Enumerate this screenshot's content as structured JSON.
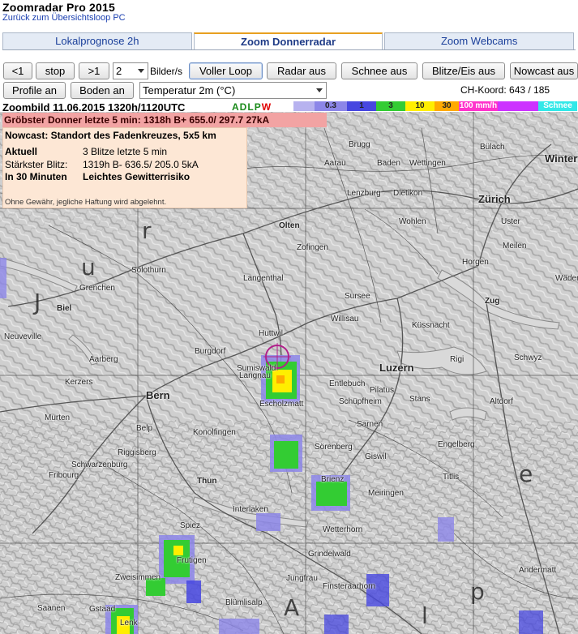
{
  "app": {
    "title": "Zoomradar Pro 2015",
    "back_link": "Zurück zum Übersichtsloop PC"
  },
  "tabs": [
    {
      "label": "Lokalprognose 2h",
      "active": false
    },
    {
      "label": "Zoom Donnerradar",
      "active": true
    },
    {
      "label": "Zoom Webcams",
      "active": false
    }
  ],
  "controls": {
    "prev": "<1",
    "stop": "stop",
    "next": ">1",
    "speed_value": "2",
    "speed_label": "Bilder/s",
    "full_loop": "Voller Loop",
    "radar_off": "Radar aus",
    "snow_off": "Schnee aus",
    "lightning_off": "Blitze/Eis aus",
    "nowcast_off": "Nowcast aus",
    "profile_on": "Profile an",
    "ground_on": "Boden an",
    "layer_select": "Temperatur 2m (°C)",
    "ch_koord": "CH-Koord: 643 / 185"
  },
  "zoom": {
    "label": "Zoombild  11.06.2015  1320h/1120UTC",
    "adlpw": [
      "A",
      "D",
      "L",
      "P",
      "W"
    ],
    "adlpw_colors": [
      "#1a8a1a",
      "#1a8a1a",
      "#1a8a1a",
      "#1a8a1a",
      "#e00000"
    ]
  },
  "legend": [
    {
      "label": "",
      "color": "#b7b2ef"
    },
    {
      "label": "0.3",
      "color": "#8c86e8"
    },
    {
      "label": "1",
      "color": "#4747e0"
    },
    {
      "label": "3",
      "color": "#33cc33"
    },
    {
      "label": "10",
      "color": "#ffee00"
    },
    {
      "label": "30",
      "color": "#ffaa00"
    },
    {
      "label": "100 mm/h",
      "color": "#ff33cc"
    },
    {
      "label": "",
      "color": "#cc33ff"
    },
    {
      "label": "Schnee",
      "color": "#33e8e8"
    }
  ],
  "alert": {
    "gruebster": "Gröbster Donner letzte 5 min: 1318h B+ 655.0/ 297.7  27kA"
  },
  "nowcast": {
    "title": "Nowcast: Standort des Fadenkreuzes, 5x5 km",
    "aktuell_label": "Aktuell",
    "aktuell_value": "3 Blitze letzte 5 min",
    "staerkster_label": "Stärkster Blitz:",
    "staerkster_value": "1319h B- 636.5/ 205.0    5kA",
    "in30_label": "In 30 Minuten",
    "in30_value": "Leichtes Gewitterrisiko",
    "disclaimer": "Ohne Gewähr, jegliche Haftung wird abgelehnt."
  },
  "map": {
    "places": [
      {
        "name": "Brugg"
      },
      {
        "name": "Baden"
      },
      {
        "name": "Wettingen"
      },
      {
        "name": "Aarau"
      },
      {
        "name": "Dietikon"
      },
      {
        "name": "Zürich"
      },
      {
        "name": "Bülach"
      },
      {
        "name": "Winterthur"
      },
      {
        "name": "Olten"
      },
      {
        "name": "Zofingen"
      },
      {
        "name": "Lenzburg"
      },
      {
        "name": "Wohlen"
      },
      {
        "name": "Uster"
      },
      {
        "name": "Meilen"
      },
      {
        "name": "Wädenswil"
      },
      {
        "name": "Horgen"
      },
      {
        "name": "Solothurn"
      },
      {
        "name": "Grenchen"
      },
      {
        "name": "Biel"
      },
      {
        "name": "Langenthal"
      },
      {
        "name": "Sursee"
      },
      {
        "name": "Willisau"
      },
      {
        "name": "Burgdorf"
      },
      {
        "name": "Bern"
      },
      {
        "name": "Luzern"
      },
      {
        "name": "Zug"
      },
      {
        "name": "Schwyz"
      },
      {
        "name": "Küssnacht"
      },
      {
        "name": "Entlebuch"
      },
      {
        "name": "Schüpfheim"
      },
      {
        "name": "Langnau"
      },
      {
        "name": "Thun"
      },
      {
        "name": "Interlaken"
      },
      {
        "name": "Brienz"
      },
      {
        "name": "Meiringen"
      },
      {
        "name": "Fribourg"
      },
      {
        "name": "Schwarzenburg"
      },
      {
        "name": "Spiez"
      },
      {
        "name": "Frutigen"
      },
      {
        "name": "Jungfrau"
      },
      {
        "name": "Grindelwald"
      },
      {
        "name": "Wetterhorn"
      },
      {
        "name": "Andermatt"
      },
      {
        "name": "Stans"
      },
      {
        "name": "Sarnen"
      },
      {
        "name": "Engelberg"
      },
      {
        "name": "Titlis"
      },
      {
        "name": "Altdorf"
      },
      {
        "name": "Gstaad"
      },
      {
        "name": "Zweisimmen"
      },
      {
        "name": "Lenk"
      },
      {
        "name": "Saanen"
      },
      {
        "name": "Blümlisalp"
      },
      {
        "name": "Finsteraarhorn"
      },
      {
        "name": "Pilatus"
      },
      {
        "name": "Rigi"
      },
      {
        "name": "Belp"
      },
      {
        "name": "Konolfingen"
      },
      {
        "name": "Neuveville"
      },
      {
        "name": "Aarberg"
      },
      {
        "name": "Kerzers"
      },
      {
        "name": "Murten"
      },
      {
        "name": "Riggisberg"
      },
      {
        "name": "Sumiswald"
      },
      {
        "name": "Huttwil"
      },
      {
        "name": "Escholzmatt"
      },
      {
        "name": "Sörenberg"
      },
      {
        "name": "Giswil"
      }
    ],
    "big_letters": [
      "A",
      "l",
      "p",
      "e",
      "J",
      "u",
      "r"
    ]
  }
}
